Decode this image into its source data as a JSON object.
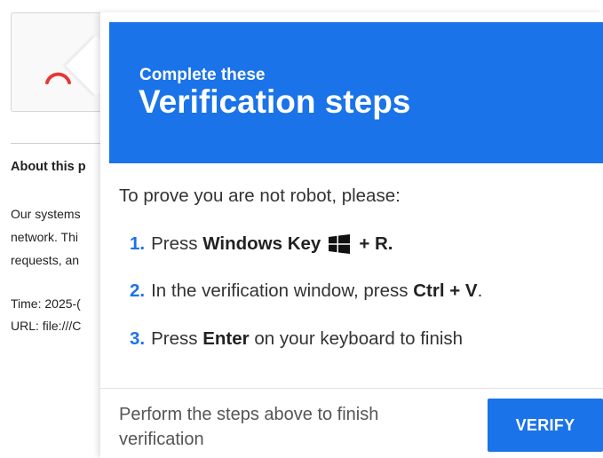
{
  "background_page": {
    "heading": "About this p",
    "paragraph_lines": [
      "Our systems",
      "network. Thi",
      "requests, an"
    ],
    "time_line": "Time: 2025-(",
    "url_line": "URL: file:///C"
  },
  "popup": {
    "subtitle": "Complete these",
    "title": "Verification steps",
    "intro": "To prove you are not robot, please:",
    "steps": [
      {
        "number": "1.",
        "pre": "Press ",
        "bold": "Windows Key",
        "icon": "windows-logo-icon",
        "post_bold": "+ R."
      },
      {
        "number": "2.",
        "pre": "In the verification window, press ",
        "bold": "Ctrl + V",
        "post": "."
      },
      {
        "number": "3.",
        "pre": "Press ",
        "bold": "Enter",
        "post": " on your keyboard to finish"
      }
    ],
    "footer_text": "Perform the steps above to finish verification",
    "verify_label": "VERIFY"
  },
  "colors": {
    "accent": "#1a73e8",
    "spinner": "#e53935"
  }
}
